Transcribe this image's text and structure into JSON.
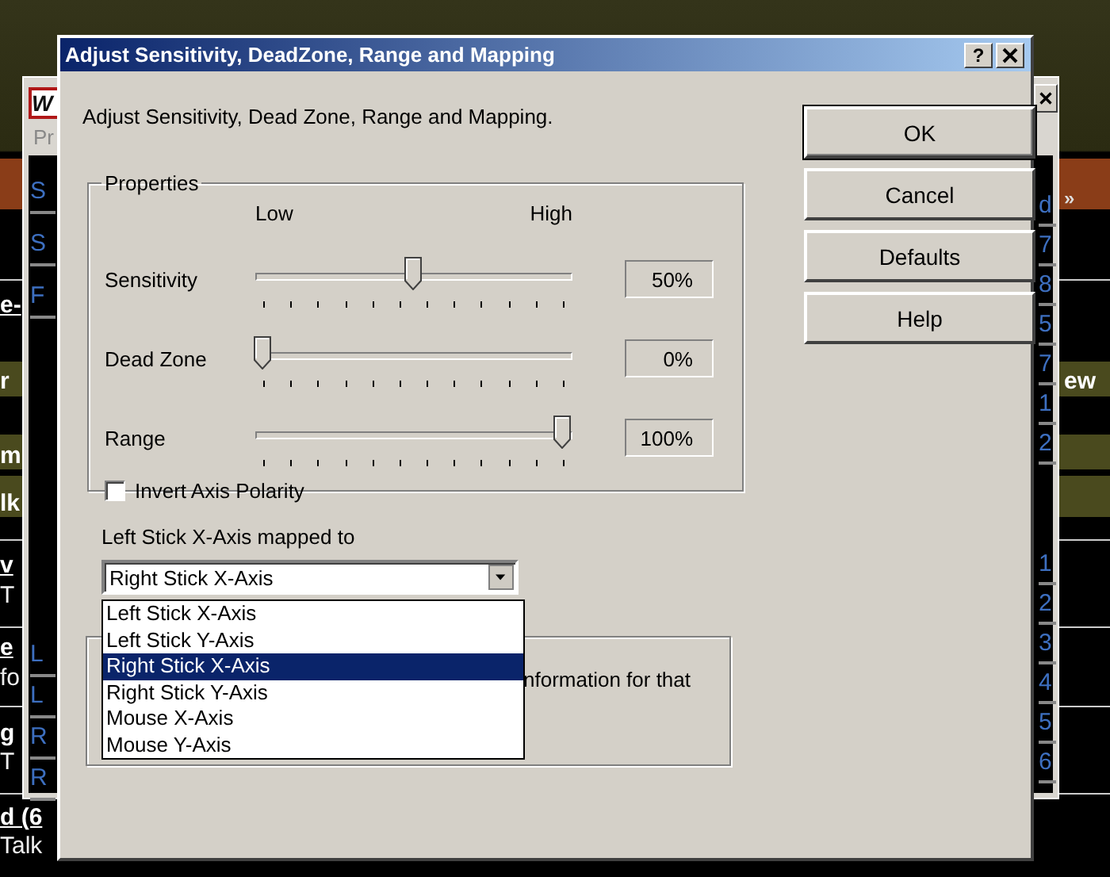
{
  "background": {
    "left_fragments": [
      {
        "text": "e-",
        "kind": "heading"
      },
      {
        "text": "r",
        "kind": "band"
      },
      {
        "text": "m",
        "kind": "band"
      },
      {
        "text": "lk",
        "kind": "band"
      },
      {
        "text": "v",
        "kind": "heading"
      },
      {
        "text": "T",
        "kind": "sub"
      },
      {
        "text": "e",
        "kind": "heading"
      },
      {
        "text": "fo",
        "kind": "sub"
      },
      {
        "text": "g",
        "kind": "heading"
      },
      {
        "text": "T",
        "kind": "sub"
      },
      {
        "text": "d (6",
        "kind": "heading"
      },
      {
        "text": "Talk",
        "kind": "sub"
      }
    ],
    "right_fragments": [
      {
        "text": "»",
        "kind": "orange"
      },
      {
        "text": "ew",
        "kind": "band"
      }
    ]
  },
  "back_window": {
    "logo": "W",
    "title_fragment": "Pr",
    "left_links": [
      "S",
      "S",
      "F",
      "L",
      "L",
      "R",
      "R"
    ],
    "right_links": [
      "d",
      "7",
      "8",
      "5",
      "7",
      "1",
      "2",
      "1",
      "2",
      "3",
      "4",
      "5",
      "6"
    ]
  },
  "dialog": {
    "title": "Adjust Sensitivity, DeadZone, Range and Mapping",
    "help_button": "?",
    "description": "Adjust Sensitivity, Dead Zone, Range and Mapping.",
    "properties": {
      "legend": "Properties",
      "low_label": "Low",
      "high_label": "High",
      "sliders": [
        {
          "label": "Sensitivity",
          "level": 0.5,
          "reading": "50%"
        },
        {
          "label": "Dead Zone",
          "level": 0,
          "reading": "0%"
        },
        {
          "label": "Range",
          "level": 1,
          "reading": "100%"
        }
      ],
      "invert_axis": {
        "label": "Invert Axis Polarity",
        "checked": false
      }
    },
    "mapping": {
      "label": "Left Stick X-Axis mapped to",
      "value": "Right Stick X-Axis",
      "expanded": true,
      "options": [
        {
          "label": "Left Stick X-Axis",
          "selected": false
        },
        {
          "label": "Left Stick Y-Axis",
          "selected": false
        },
        {
          "label": "Right Stick X-Axis",
          "selected": true
        },
        {
          "label": "Right Stick Y-Axis",
          "selected": false
        },
        {
          "label": "Mouse X-Axis",
          "selected": false
        },
        {
          "label": "Mouse Y-Axis",
          "selected": false
        }
      ]
    },
    "info_text": "nformation for that",
    "buttons": [
      {
        "label": "OK",
        "default": true
      },
      {
        "label": "Cancel",
        "default": false
      },
      {
        "label": "Defaults",
        "default": false
      },
      {
        "label": "Help",
        "default": false
      }
    ]
  }
}
